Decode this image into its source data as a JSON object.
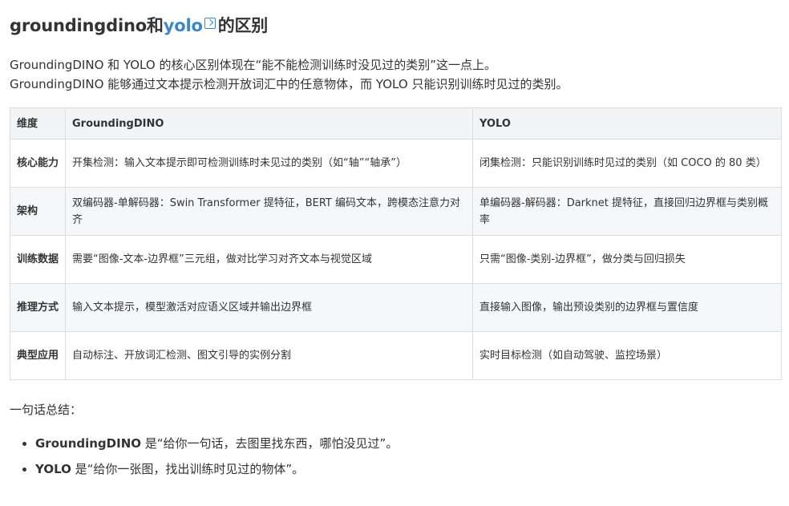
{
  "title": {
    "prefix": "groundingdino和",
    "link": "yolo",
    "suffix": "的区别"
  },
  "intro": [
    "GroundingDINO 和 YOLO 的核心区别体现在“能不能检测训练时没见过的类别”这一点上。",
    "GroundingDINO 能够通过文本提示检测开放词汇中的任意物体，而 YOLO 只能识别训练时见过的类别。"
  ],
  "table": {
    "headers": [
      "维度",
      "GroundingDINO",
      "YOLO"
    ],
    "rows": [
      [
        "核心能力",
        "开集检测：输入文本提示即可检测训练时未见过的类别（如“轴”“轴承”）",
        "闭集检测：只能识别训练时见过的类别（如 COCO 的 80 类）"
      ],
      [
        "架构",
        "双编码器-单解码器：Swin Transformer 提特征，BERT 编码文本，跨模态注意力对齐",
        "单编码器-解码器：Darknet 提特征，直接回归边界框与类别概率"
      ],
      [
        "训练数据",
        "需要“图像-文本-边界框”三元组，做对比学习对齐文本与视觉区域",
        "只需“图像-类别-边界框”，做分类与回归损失"
      ],
      [
        "推理方式",
        "输入文本提示，模型激活对应语义区域并输出边界框",
        "直接输入图像，输出预设类别的边界框与置信度"
      ],
      [
        "典型应用",
        "自动标注、开放词汇检测、图文引导的实例分割",
        "实时目标检测（如自动驾驶、监控场景）"
      ]
    ]
  },
  "summary": "一句话总结：",
  "points": [
    {
      "term": "GroundingDINO",
      "text": " 是“给你一句话，去图里找东西，哪怕没见过”。"
    },
    {
      "term": "YOLO",
      "text": " 是“给你一张图，找出训练时见过的物体”。"
    }
  ]
}
